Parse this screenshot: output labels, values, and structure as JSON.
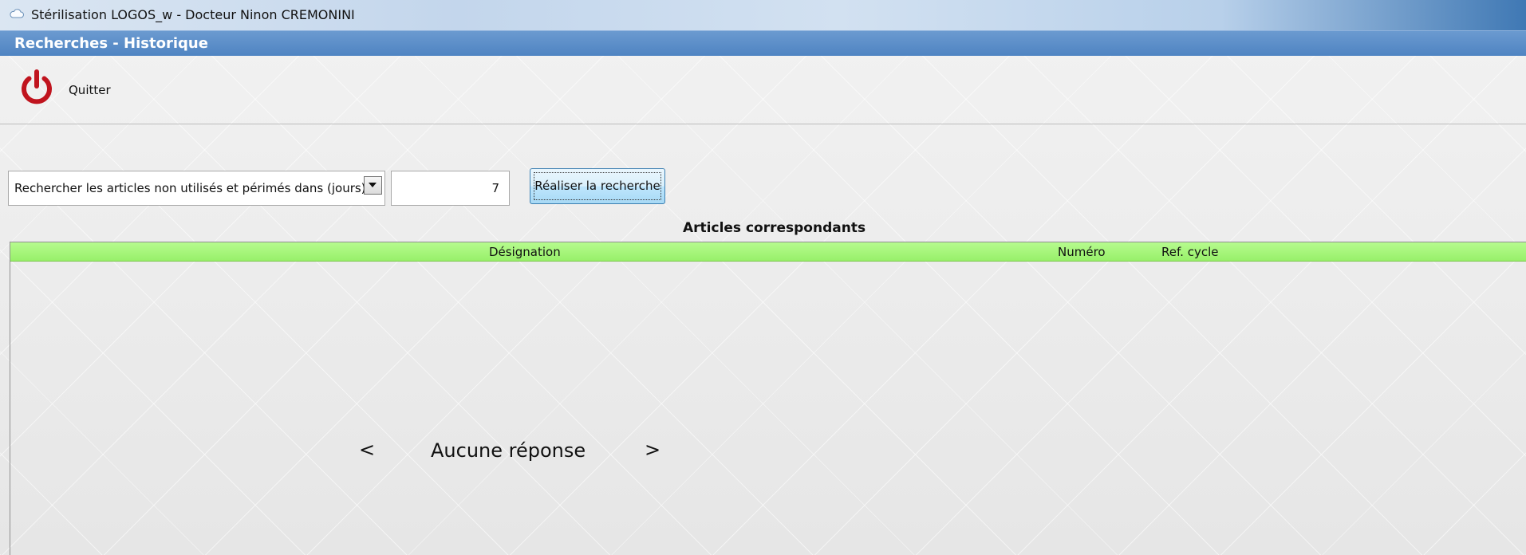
{
  "window": {
    "title": "Stérilisation  LOGOS_w - Docteur Ninon CREMONINI",
    "app_icon": "cloud-icon"
  },
  "header": {
    "title": "Recherches - Historique"
  },
  "toolbar": {
    "quit_label": "Quitter",
    "quit_icon": "power-icon",
    "quit_icon_color": "#c0141e"
  },
  "search": {
    "criteria_selected": "Rechercher les articles non utilisés et périmés dans (jours) :",
    "days_value": "7",
    "button_label": "Réaliser la recherche"
  },
  "results": {
    "title": "Articles correspondants",
    "columns": [
      "Désignation",
      "Numéro",
      "Ref. cycle"
    ],
    "header_color": "#a6f57b",
    "empty_message": "Aucune réponse",
    "prev_label": "<",
    "next_label": ">"
  }
}
